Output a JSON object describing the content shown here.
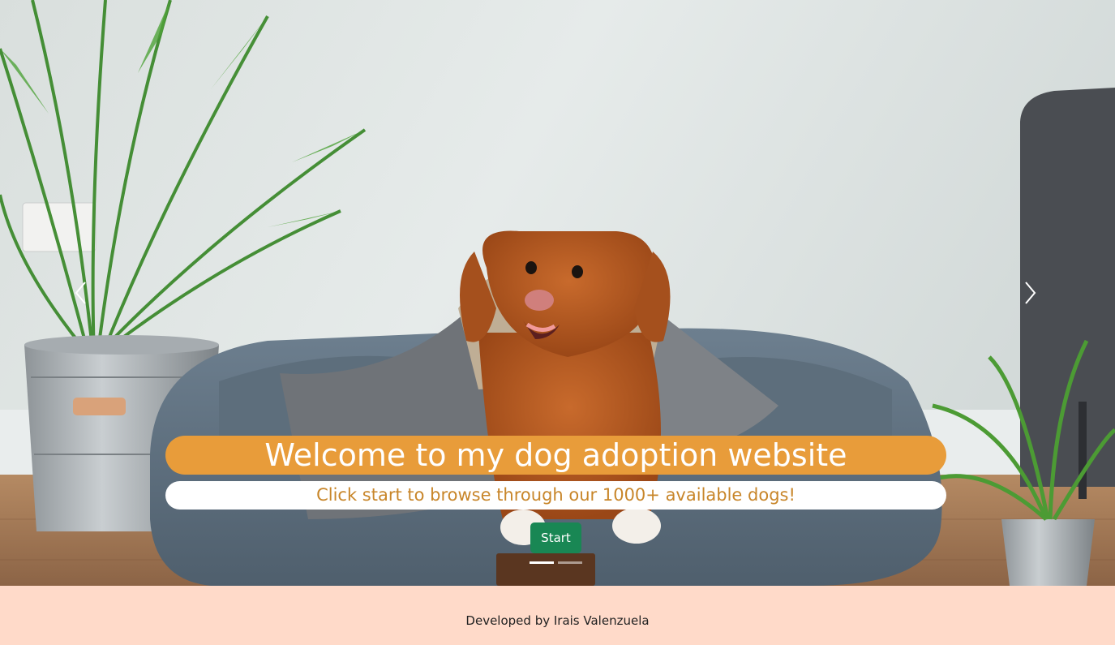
{
  "carousel": {
    "slide": {
      "image": "dog-on-bed-photo",
      "title": "Welcome to my dog adoption website",
      "subtitle": "Click start to browse through our 1000+ available dogs!",
      "button_label": "Start"
    },
    "indicator_count": 2,
    "active_indicator": 1,
    "prev_icon": "chevron-left-icon",
    "next_icon": "chevron-right-icon"
  },
  "footer": {
    "text": "Developed by Irais Valenzuela"
  },
  "colors": {
    "title_pill": "#e89c3a",
    "subtitle_text": "#c8862a",
    "start_button": "#198754",
    "footer_bg": "#ffdac9"
  }
}
